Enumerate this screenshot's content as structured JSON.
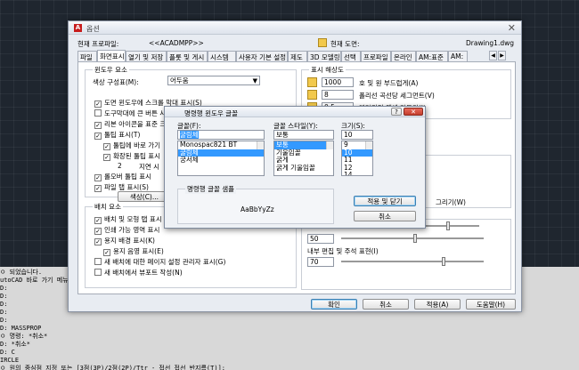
{
  "cmdline": {
    "lines": [
      "ㅇ 되었습니다.",
      "utoCAD 바로 가기 메뉴를 사용하여 드",
      "D:",
      "D:",
      "D:",
      "D:",
      "D:",
      "D: MASSPROP",
      "ㅇ 명령: *취소*",
      "D: *취소*",
      "D: C",
      "IRCLE",
      "ㅇ 원의 중심점 지정 또는 [3점(3P)/2점(2P)/Ttr - 접선 접선 반지름(T)]:"
    ]
  },
  "options": {
    "title": "옵션",
    "profile_label": "현재 프로파일:",
    "profile_value": "<<ACADMPP>>",
    "drawing_label": "현재 도면:",
    "drawing_value": "Drawing1.dwg",
    "tabs": [
      "파일",
      "화면표시",
      "열기 및 저장",
      "플롯 및 게시",
      "시스템",
      "사용자 기본 설정",
      "제도",
      "3D 모델링",
      "선택",
      "프로파일",
      "온라인",
      "AM:표준",
      "AM:"
    ],
    "window_group": {
      "legend": "윈도우 요소",
      "color_scheme_label": "색상 구성표(M):",
      "color_scheme_value": "어두움",
      "items": [
        "도면 윈도우에 스크롤 막대 표시(S)",
        "도구막대에 큰 버튼 사용",
        "리본 아이콘을 표준 크기로",
        "툴팁 표시(T)",
        "툴팁에 바로 가기",
        "확장된 툴팁 표시",
        "지연 시",
        "롤오버 툴팁 표시",
        "파일 탭 표시(S)"
      ],
      "delay_value": "2",
      "colors_button": "색상(C)..."
    },
    "layout_group": {
      "legend": "배치 요소",
      "items": [
        "배치 및 모형 탭 표시",
        "인쇄 가능 영역 표시",
        "용지 배경 표시(K)",
        "용지 음영 표시(E)",
        "새 배치에 대한 페이지 설정 관리자 표시(G)",
        "새 배치에서 뷰포트 작성(N)"
      ]
    },
    "resolution_group": {
      "legend": "표시 해상도",
      "items": [
        {
          "value": "1000",
          "label": "호 및 원 부드럽게(A)"
        },
        {
          "value": "8",
          "label": "폴리선 곡선당 세그먼트(V)"
        },
        {
          "value": "0.5",
          "label": "렌더링된 객체 다듬기(J)"
        }
      ]
    },
    "right_partial": {
      "grip_text": "그리기(W)",
      "fade_value": "50",
      "inplace_label": "내부 편집 및 주석 표현(I)",
      "inplace_value": "70"
    },
    "buttons": {
      "ok": "확인",
      "cancel": "취소",
      "apply": "적용(A)",
      "help": "도움말(H)"
    }
  },
  "font_dialog": {
    "title": "명령행 윈도우 글꼴",
    "font_label": "글꼴(F):",
    "font_value": "굴림체",
    "font_list": [
      "Monospac821 BT",
      "굴림체",
      "궁서체"
    ],
    "font_selected": "굴림체",
    "style_label": "글꼴 스타일(Y):",
    "style_value": "보통",
    "style_list": [
      "보통",
      "기울임꼴",
      "굵게",
      "굵게 기울임꼴"
    ],
    "style_selected": "보통",
    "size_label": "크기(S):",
    "size_value": "10",
    "size_list": [
      "9",
      "10",
      "11",
      "12",
      "14",
      "16"
    ],
    "size_selected": "10",
    "sample_label": "명령행 글꼴 샘플",
    "sample_text": "AaBbYyZz",
    "apply_close": "적용 및 닫기",
    "cancel": "취소",
    "help_glyph": "?"
  },
  "colors": {
    "selection": "#3399ff",
    "autocad_red": "#c81d1d"
  }
}
